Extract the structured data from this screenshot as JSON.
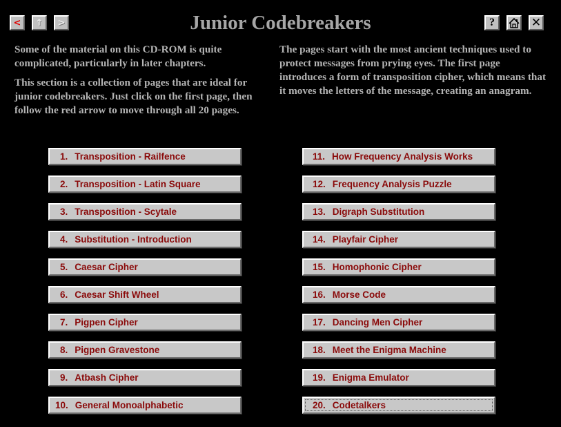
{
  "window": {
    "title": "Junior Codebreakers"
  },
  "toolbar": {
    "prev_icon": "left-arrow-icon",
    "prev_glyph": "<",
    "up_icon": "up-arrow-icon",
    "up_glyph": "↑",
    "next_icon": "right-arrow-icon",
    "next_glyph": ">",
    "help_icon": "help-icon",
    "help_glyph": "?",
    "home_icon": "home-icon",
    "close_icon": "close-icon",
    "close_glyph": "✕"
  },
  "intro": {
    "left_para_1": "Some of the material on this CD-ROM is quite complicated, particularly in later chapters.",
    "left_para_2": "This section is a collection of pages that are ideal for junior codebreakers. Just click on the first page, then follow the red arrow to move through all 20 pages.",
    "right_para": "The pages start with the most ancient techniques used to protect messages from prying eyes. The first page introduces a form of transposition cipher, which means that it moves the letters of the message, creating an anagram."
  },
  "pages": {
    "left": [
      {
        "num": "1.",
        "label": "Transposition - Railfence"
      },
      {
        "num": "2.",
        "label": "Transposition - Latin Square"
      },
      {
        "num": "3.",
        "label": "Transposition - Scytale"
      },
      {
        "num": "4.",
        "label": "Substitution - Introduction"
      },
      {
        "num": "5.",
        "label": "Caesar Cipher"
      },
      {
        "num": "6.",
        "label": "Caesar Shift Wheel"
      },
      {
        "num": "7.",
        "label": "Pigpen Cipher"
      },
      {
        "num": "8.",
        "label": "Pigpen Gravestone"
      },
      {
        "num": "9.",
        "label": "Atbash Cipher"
      },
      {
        "num": "10.",
        "label": "General Monoalphabetic"
      }
    ],
    "right": [
      {
        "num": "11.",
        "label": "How Frequency Analysis Works"
      },
      {
        "num": "12.",
        "label": "Frequency Analysis Puzzle"
      },
      {
        "num": "13.",
        "label": "Digraph Substitution"
      },
      {
        "num": "14.",
        "label": "Playfair Cipher"
      },
      {
        "num": "15.",
        "label": "Homophonic Cipher"
      },
      {
        "num": "16.",
        "label": "Morse Code"
      },
      {
        "num": "17.",
        "label": "Dancing Men Cipher"
      },
      {
        "num": "18.",
        "label": "Meet the Enigma Machine"
      },
      {
        "num": "19.",
        "label": "Enigma Emulator"
      },
      {
        "num": "20.",
        "label": "Codetalkers"
      }
    ]
  },
  "colors": {
    "background": "#000000",
    "title": "#a6a6a6",
    "body_text": "#b4b4b4",
    "button_face": "#c8c8c8",
    "button_text": "#8a0a0a",
    "prev_arrow": "#e00000"
  }
}
